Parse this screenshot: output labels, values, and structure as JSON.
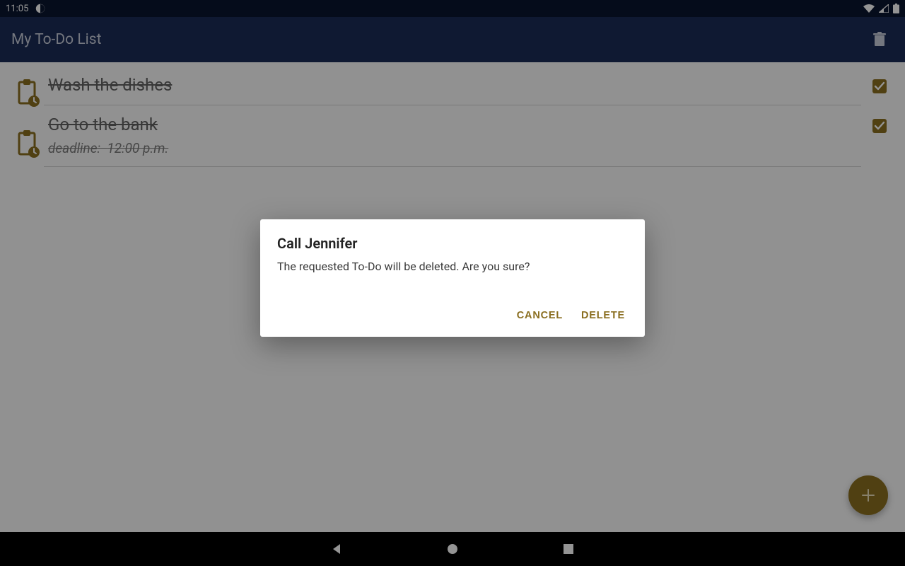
{
  "status": {
    "time": "11:05"
  },
  "appbar": {
    "title": "My To-Do List"
  },
  "todos": [
    {
      "title": "Wash the dishes",
      "deadline_label": "",
      "deadline_value": "",
      "done": true
    },
    {
      "title": "Go to the bank",
      "deadline_label": "deadline:",
      "deadline_value": "12:00 p.m.",
      "done": true
    }
  ],
  "dialog": {
    "title": "Call Jennifer",
    "message": "The requested To-Do will be deleted. Are you sure?",
    "cancel": "CANCEL",
    "delete": "DELETE"
  },
  "colors": {
    "accent": "#8a6e20",
    "appbar": "#1b2b56"
  }
}
